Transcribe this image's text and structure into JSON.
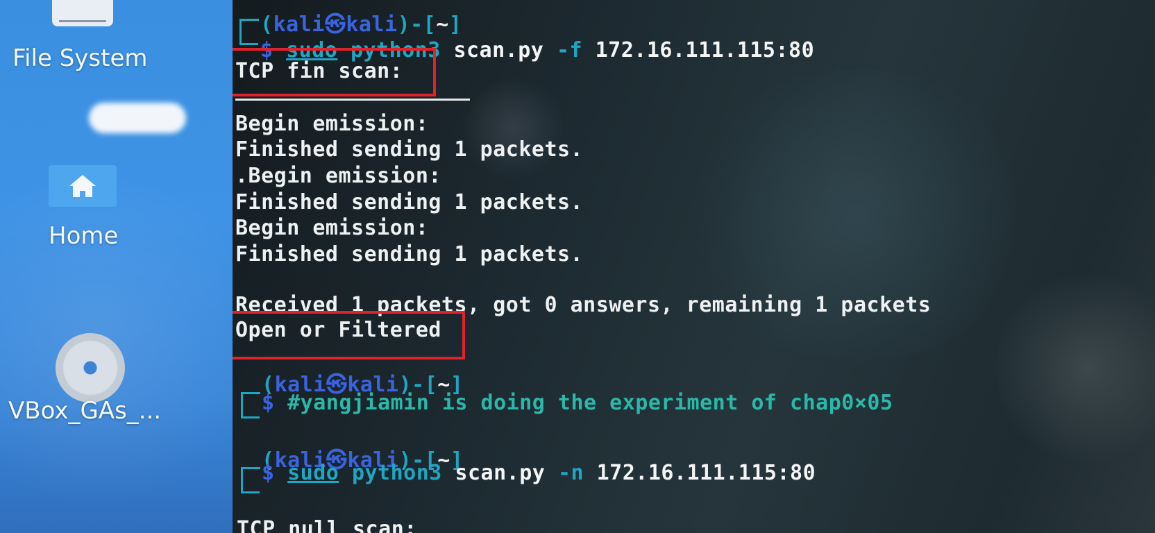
{
  "desktop": {
    "icons": [
      {
        "label": "File System",
        "icon": "drive-icon"
      },
      {
        "label": "Home",
        "icon": "home-icon"
      },
      {
        "label": "VBox_GAs_...",
        "icon": "disc-icon"
      }
    ]
  },
  "terminal": {
    "prompt": {
      "user": "kali",
      "at": "㉿",
      "host": "kali",
      "path": "~",
      "dollar": "$"
    },
    "cmd1": {
      "sudo": "sudo",
      "prog": "python3",
      "file": "scan.py",
      "flag": "-f",
      "addr": "172.16.111.115:80"
    },
    "out": [
      "TCP fin scan:",
      "Begin emission:",
      "Finished sending 1 packets.",
      ".Begin emission:",
      "Finished sending 1 packets.",
      "Begin emission:",
      "Finished sending 1 packets.",
      "Received 1 packets, got 0 answers, remaining 1 packets",
      "Open or Filtered"
    ],
    "comment_line": "#yangjiamin is doing the experiment of chap0×05",
    "cmd2": {
      "sudo": "sudo",
      "prog": "python3",
      "file": "scan.py",
      "flag": "-n",
      "addr": "172.16.111.115:80"
    },
    "cut_line": "TCP null scan:"
  },
  "colors": {
    "highlight_box": "#e2222b",
    "prompt_cyan": "#1fa6c2",
    "host_blue": "#3a63e0",
    "comment_teal": "#2bb8a8"
  }
}
